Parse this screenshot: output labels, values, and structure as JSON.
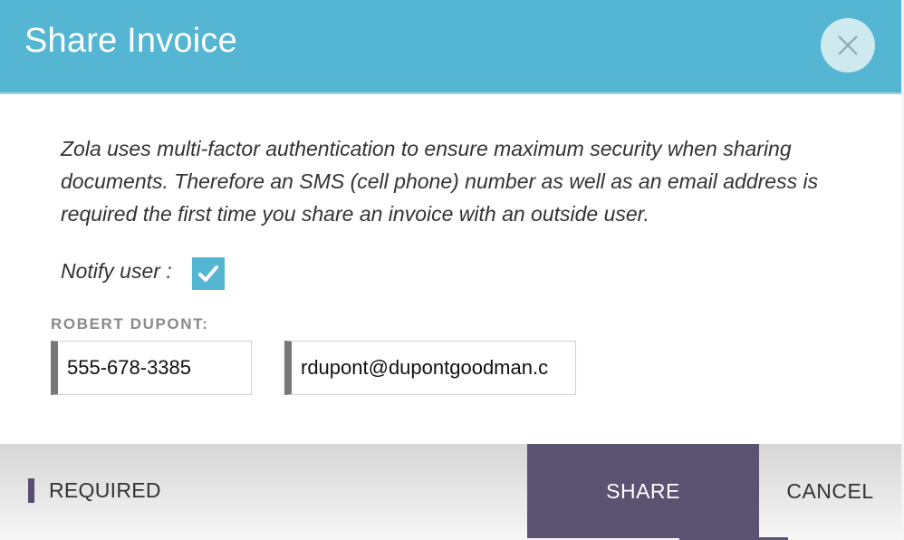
{
  "dialog": {
    "title": "Share Invoice",
    "close_icon": "close-icon"
  },
  "intro": {
    "text": "Zola uses multi-factor authentication to ensure maximum security when sharing documents. Therefore an SMS (cell phone) number as well as an email address is required the first time you share an invoice with an outside user."
  },
  "notify": {
    "label": "Notify user :",
    "checked": true,
    "icon": "checkmark-icon"
  },
  "recipient": {
    "name_label": "ROBERT DUPONT:",
    "phone": "555-678-3385",
    "email": "rdupont@dupontgoodman.c"
  },
  "footer": {
    "required_label": "REQUIRED",
    "share_label": "SHARE",
    "cancel_label": "CANCEL"
  },
  "colors": {
    "header": "#55b6d3",
    "accent": "#5b5372",
    "required_marker": "#5a4e74",
    "field_marker": "#777777"
  }
}
